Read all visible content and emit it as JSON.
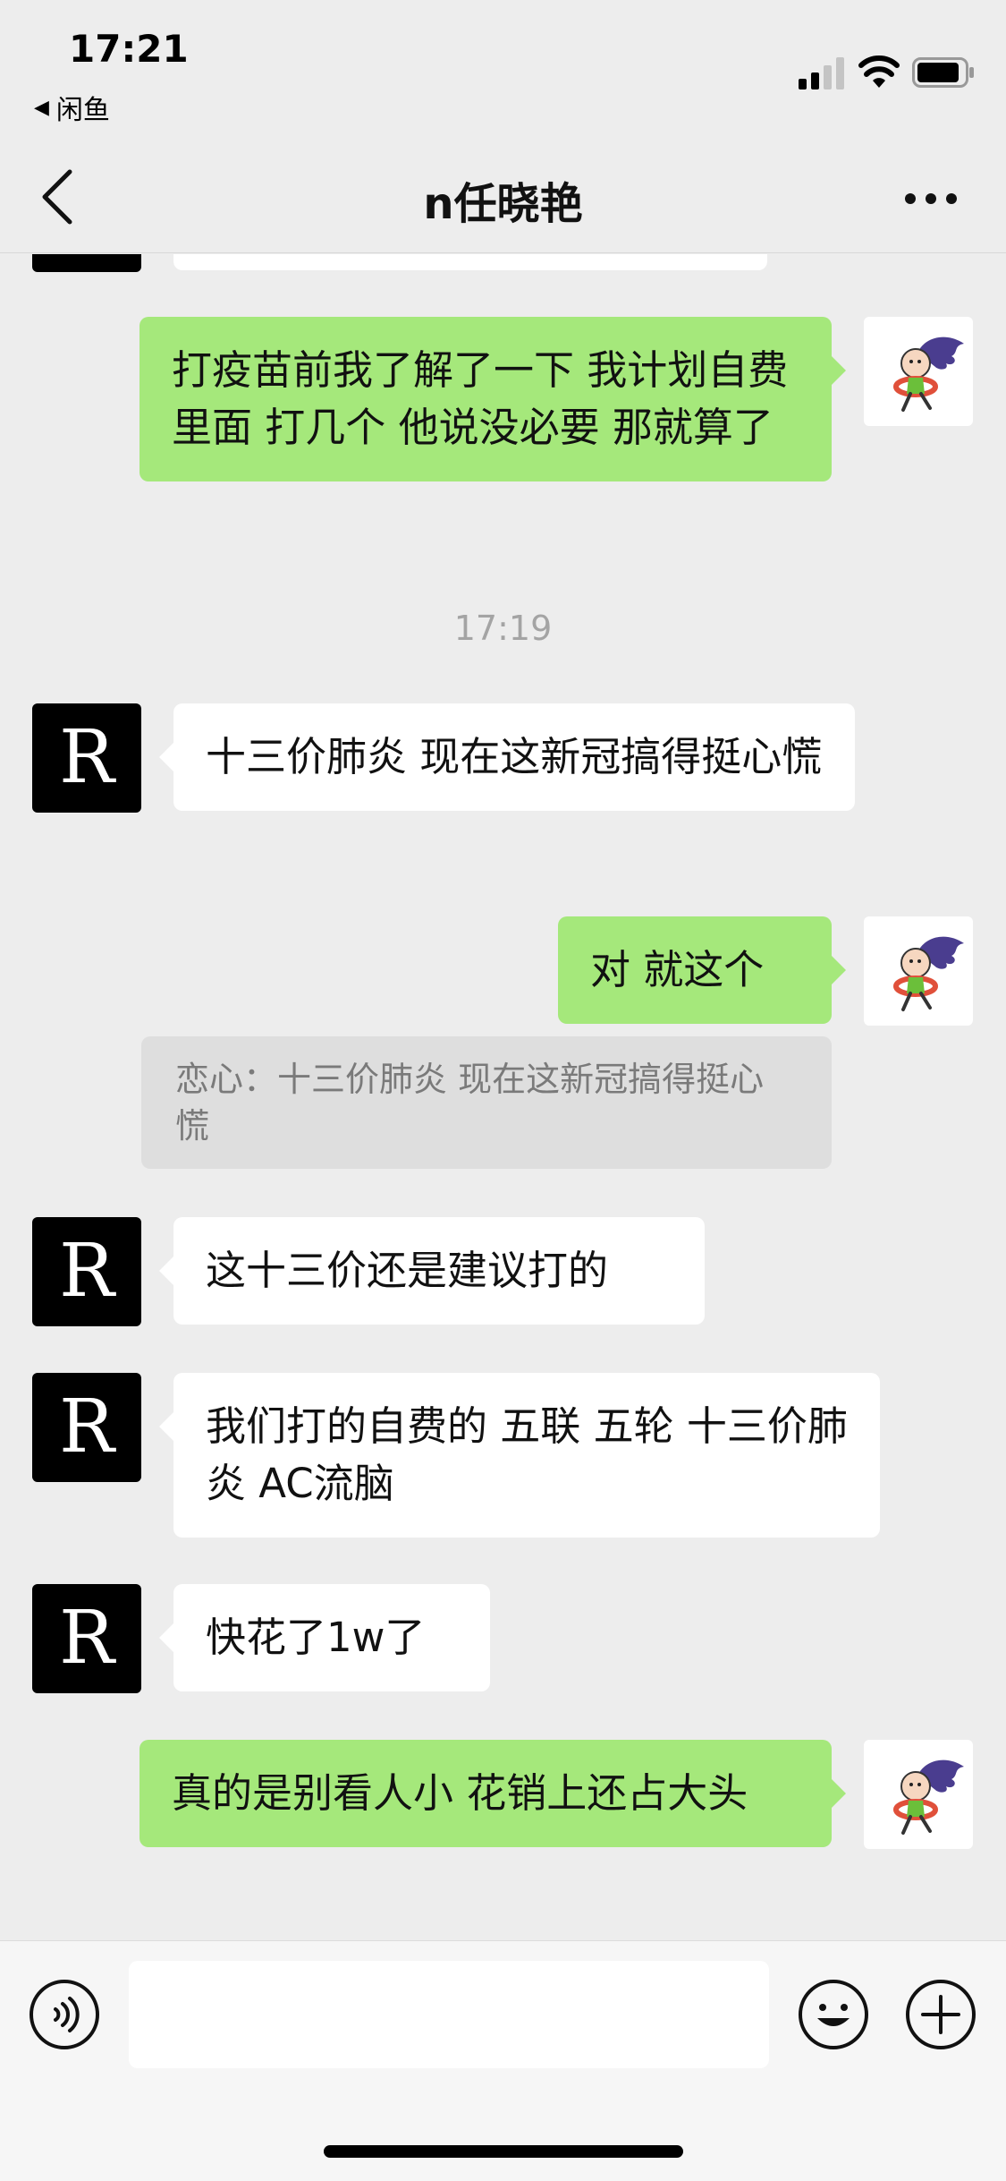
{
  "status_bar": {
    "time": "17:21",
    "back_app": "闲鱼"
  },
  "nav": {
    "title": "n任晓艳",
    "back_icon": "chevron-left-icon",
    "more_icon": "more-dots-icon"
  },
  "contact_avatar_letter": "R",
  "messages": [
    {
      "side": "me",
      "text": "打疫苗前我了解了一下  我计划自费里面  打几个  他说没必要  那就算了"
    },
    {
      "side": "time",
      "text": "17:19"
    },
    {
      "side": "other",
      "text": "十三价肺炎 现在这新冠搞得挺心慌"
    },
    {
      "side": "me",
      "text": "对  就这个",
      "quote": "恋心：十三价肺炎 现在这新冠搞得挺心慌"
    },
    {
      "side": "other",
      "text": "这十三价还是建议打的"
    },
    {
      "side": "other",
      "text": "我们打的自费的 五联 五轮 十三价肺炎 AC流脑"
    },
    {
      "side": "other",
      "text": "快花了1w了"
    },
    {
      "side": "me",
      "text": "真的是别看人小  花销上还占大头"
    }
  ],
  "bottom_bar": {
    "voice_icon": "voice-icon",
    "emoji_icon": "emoji-icon",
    "plus_icon": "plus-icon",
    "input_value": ""
  }
}
